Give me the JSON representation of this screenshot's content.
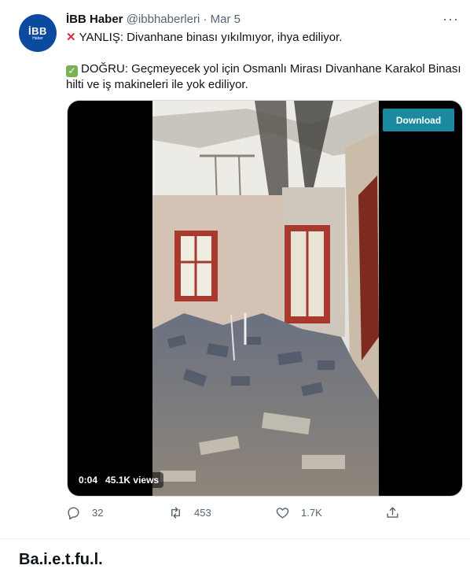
{
  "tweet": {
    "avatar_logo": "İBB",
    "avatar_sub": "Haber",
    "display_name": "İBB Haber",
    "handle": "@ibbhaberleri",
    "separator": " · ",
    "date": "Mar 5",
    "more_label": "···",
    "line1": "YANLIŞ: Divanhane binası yıkılmıyor, ihya ediliyor.",
    "line2": "DOĞRU: Geçmeyecek yol için Osmanlı Mirası Divanhane Karakol Binası",
    "line3": "hilti ve iş makineleri ile yok ediliyor.",
    "icons": {
      "wrong": "cross-mark-icon",
      "right": "check-mark-icon"
    },
    "colors": {
      "cross": "#dd2e44",
      "check": "#77b255",
      "download": "#1b8a9e"
    }
  },
  "media": {
    "download_label": "Download",
    "duration": "0:04",
    "views": "45.1K views"
  },
  "actions": {
    "reply_count": "32",
    "retweet_count": "453",
    "like_count": "1.7K"
  },
  "footer": {
    "title": "Ba.i.e.t.fu.l."
  }
}
